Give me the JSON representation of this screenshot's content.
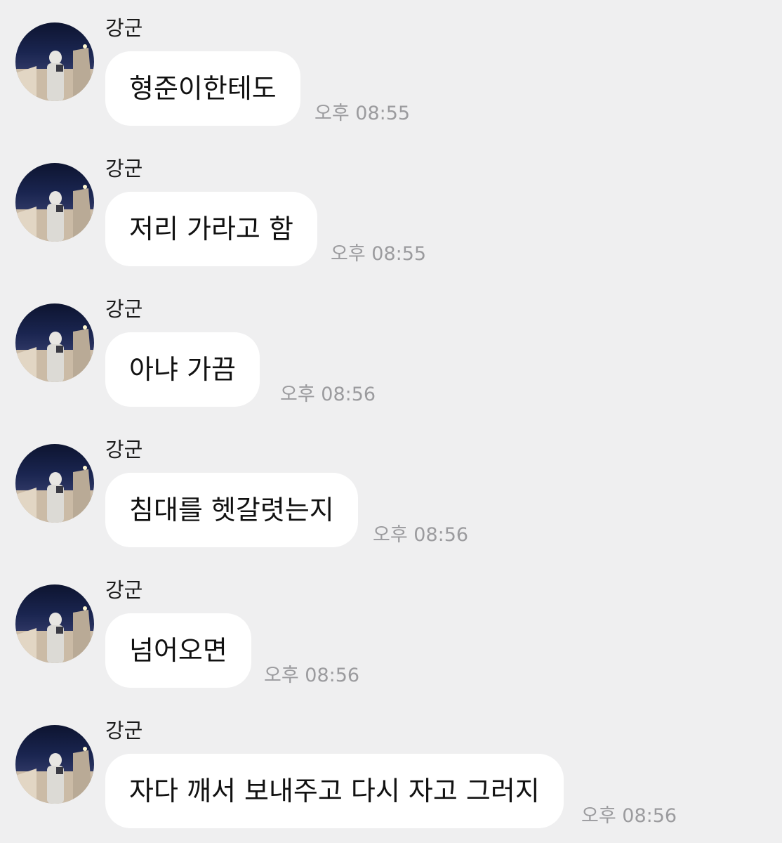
{
  "messages": [
    {
      "sender": "강군",
      "avatar_icon": "profile-photo-icon",
      "text": "형준이한테도",
      "time": "오후 08:55"
    },
    {
      "sender": "강군",
      "avatar_icon": "profile-photo-icon",
      "text": "저리 가라고 함",
      "time": "오후 08:55"
    },
    {
      "sender": "강군",
      "avatar_icon": "profile-photo-icon",
      "text": "아냐 가끔",
      "time": "오후 08:56"
    },
    {
      "sender": "강군",
      "avatar_icon": "profile-photo-icon",
      "text": "침대를 헷갈렷는지",
      "time": "오후 08:56"
    },
    {
      "sender": "강군",
      "avatar_icon": "profile-photo-icon",
      "text": "넘어오면",
      "time": "오후 08:56"
    },
    {
      "sender": "강군",
      "avatar_icon": "profile-photo-icon",
      "text": "자다 깨서 보내주고 다시 자고 그러지",
      "time": "오후 08:56"
    }
  ],
  "colors": {
    "background": "#efeff0",
    "bubble": "#ffffff",
    "time_text": "#9b9b9e"
  }
}
